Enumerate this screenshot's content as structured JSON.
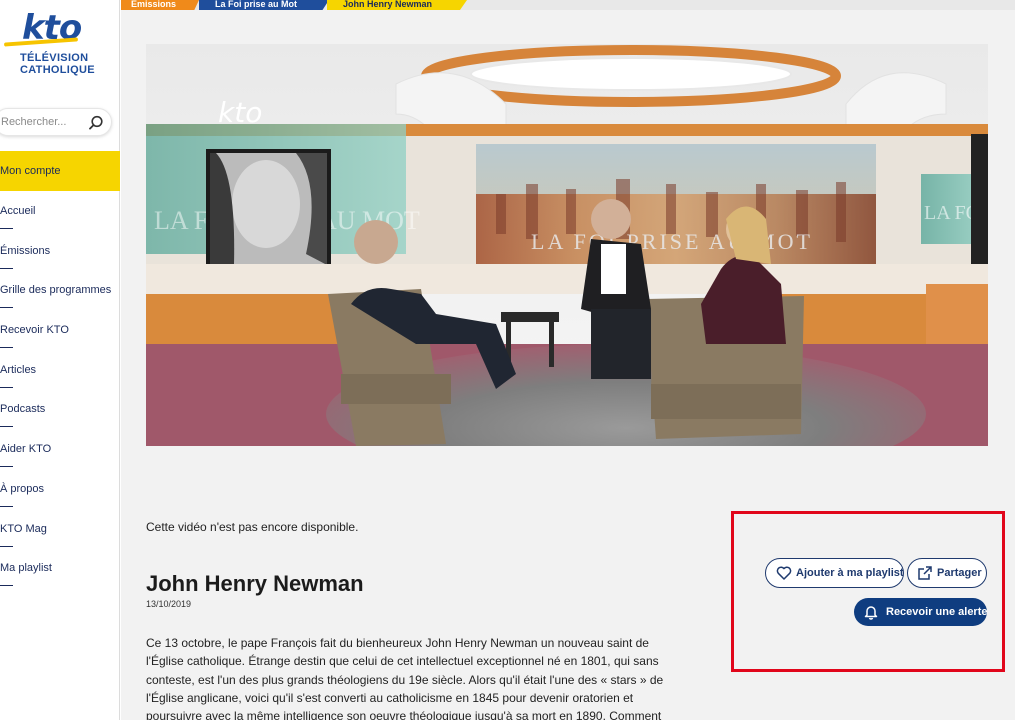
{
  "brand": {
    "logo_text": "kto",
    "tagline_1": "TÉLÉVISION",
    "tagline_2": "CATHOLIQUE"
  },
  "search": {
    "placeholder": "Rechercher..."
  },
  "account": {
    "label": "Mon compte"
  },
  "nav": {
    "items": [
      {
        "label": "Accueil"
      },
      {
        "label": "Émissions"
      },
      {
        "label": "Grille des programmes"
      },
      {
        "label": "Recevoir KTO"
      },
      {
        "label": "Articles"
      },
      {
        "label": "Podcasts"
      },
      {
        "label": "Aider KTO"
      },
      {
        "label": "À propos"
      },
      {
        "label": "KTO Mag"
      },
      {
        "label": "Ma playlist"
      }
    ]
  },
  "breadcrumb": {
    "items": [
      "Émissions",
      "La Foi prise au Mot",
      "John Henry Newman"
    ]
  },
  "video": {
    "logo_text": "kto",
    "screen_text": "LA FOI PRISE AU MOT",
    "side_left_text": "LA FOI PRISE AU MOT",
    "side_right_text": "LA FOI"
  },
  "content": {
    "unavailable": "Cette vidéo n'est pas encore disponible.",
    "title": "John Henry Newman",
    "date": "13/10/2019",
    "description_lines": [
      "Ce 13 octobre, le pape François fait du bienheureux John Henry Newman un nouveau saint de",
      "l'Église catholique. Étrange destin que celui de cet intellectuel exceptionnel né en 1801, qui sans",
      "conteste, est l'un des plus grands théologiens du 19e siècle. Alors qu'il était l'une des « stars » de",
      "l'Église anglicane, voici qu'il s'est converti au catholicisme en 1845 pour devenir oratorien et",
      "poursuivre avec la même intelligence son oeuvre théologique jusqu'à sa mort en 1890. Comment"
    ]
  },
  "actions": {
    "playlist_label": "Ajouter à ma playlist",
    "share_label": "Partager",
    "alert_label": "Recevoir une alerte"
  },
  "colors": {
    "brand_blue": "#1f4e9c",
    "brand_yellow": "#f6d500",
    "crumb_orange": "#f08a1a",
    "alert_blue": "#0f3d80",
    "highlight_red": "#e1061b"
  }
}
